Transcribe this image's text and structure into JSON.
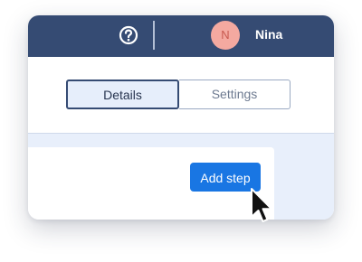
{
  "header": {
    "help_icon": "question-circle-icon",
    "avatar_initial": "N",
    "user_name": "Nina",
    "colors": {
      "topbar": "#354b73",
      "avatar_bg": "#f4a9a0"
    }
  },
  "tabs": [
    {
      "label": "Details",
      "active": true
    },
    {
      "label": "Settings",
      "active": false
    }
  ],
  "actions": {
    "add_step_label": "Add step",
    "accent": "#1976e3"
  },
  "cursor": "arrow-pointer-icon"
}
